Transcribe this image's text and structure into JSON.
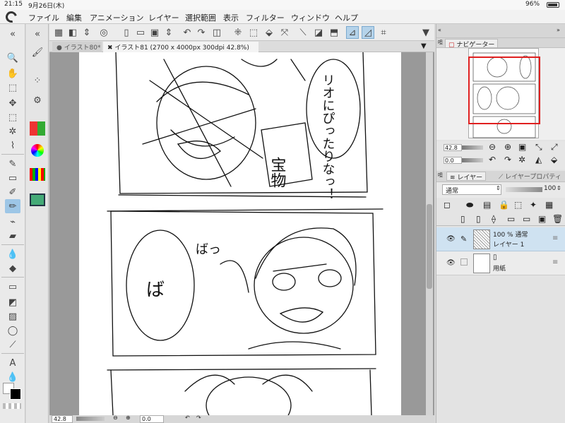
{
  "status_bar": {
    "time": "21:15",
    "date": "9月26日(木)",
    "battery": "96%"
  },
  "menu": [
    "ファイル",
    "編集",
    "アニメーション",
    "レイヤー",
    "選択範囲",
    "表示",
    "フィルター",
    "ウィンドウ",
    "ヘルプ"
  ],
  "tabs": [
    {
      "label": "● イラスト80*"
    },
    {
      "label": "✖ イラスト81 (2700 x 4000px 300dpi 42.8%)"
    }
  ],
  "canvas_bar": {
    "zoom": "42.8",
    "angle": "0.0"
  },
  "navigator": {
    "tab": "ナビゲーター",
    "zoom": "42.8",
    "angle": "0.0"
  },
  "layers_panel": {
    "tab_layers": "レイヤー",
    "tab_properties": "レイヤープロパティ",
    "blend_mode": "通常",
    "opacity": "100"
  },
  "layers": [
    {
      "line1": "100 % 通常",
      "line2": "レイヤー 1",
      "selected": true
    },
    {
      "line1": "用紙",
      "line2": "",
      "selected": false
    }
  ],
  "sketch_text": {
    "bubble1": "リオにぴったりなっ！",
    "sign": "宝物",
    "ba": "ば",
    "ba2": "ばっ"
  },
  "colors": {
    "accent": "#9dc6e6",
    "selected_layer": "#cfe2f1",
    "nav_rect": "#e02020"
  }
}
